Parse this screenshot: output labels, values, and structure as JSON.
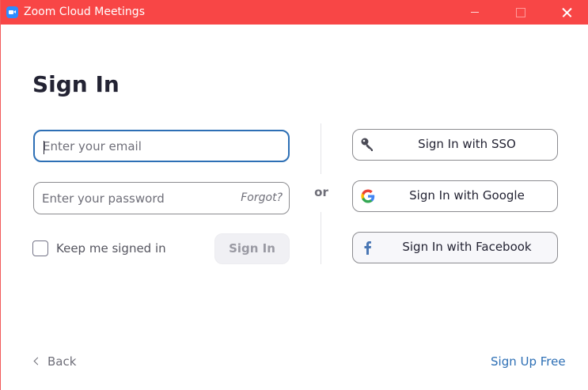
{
  "window": {
    "title": "Zoom Cloud Meetings",
    "titlebar_color": "#f84646"
  },
  "page": {
    "heading": "Sign In"
  },
  "form": {
    "email_placeholder": "Enter your email",
    "email_value": "",
    "password_placeholder": "Enter your password",
    "password_value": "",
    "forgot_label": "Forgot?",
    "keep_signed_in_label": "Keep me signed in",
    "keep_signed_in_checked": false,
    "sign_in_label": "Sign In"
  },
  "separator": {
    "or_label": "or"
  },
  "social": {
    "sso_label": "Sign In with SSO",
    "sso_icon": "key-icon",
    "google_label": "Sign In with Google",
    "google_icon": "google-icon",
    "facebook_label": "Sign In with Facebook",
    "facebook_icon": "facebook-icon"
  },
  "footer": {
    "back_label": "Back",
    "sign_up_label": "Sign Up Free"
  },
  "colors": {
    "accent": "#2d6fb5",
    "text": "#232333",
    "muted": "#6e6e78"
  }
}
